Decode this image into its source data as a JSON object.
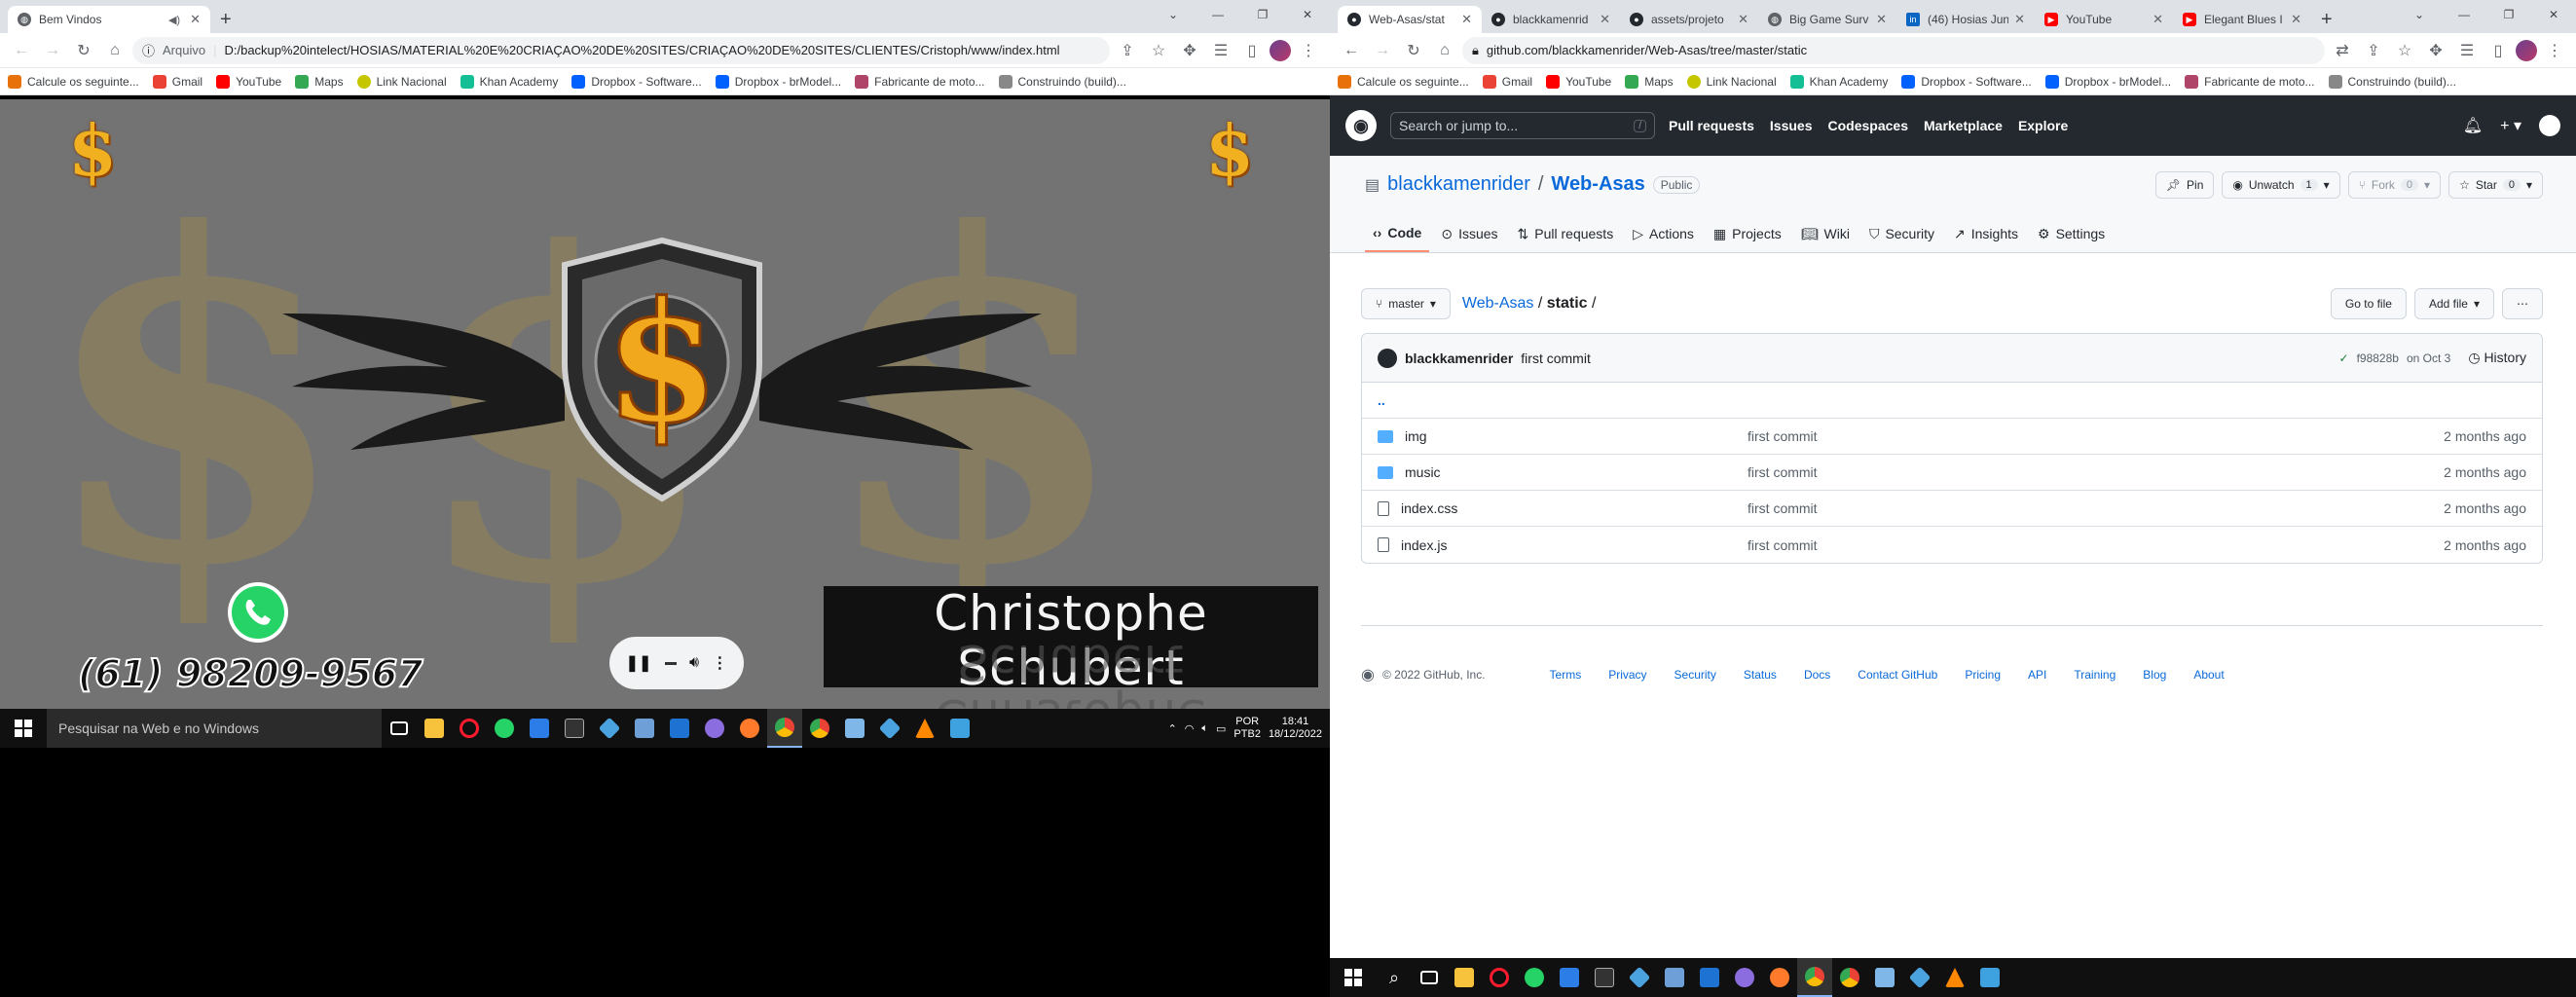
{
  "left": {
    "tabs": [
      {
        "title": "Bem Vindos"
      }
    ],
    "address_prefix": "Arquivo",
    "address": "D:/backup%20intelect/HOSIAS/MATERIAL%20E%20CRIA%C3%87%C3%83O%20DE%20SITES/CRIA%C3%87%C3%83O%20DE%20SITES/CLIENTES/Cristoph/www/index.html",
    "address_display": "D:/backup%20intelect/HOSIAS/MATERIAL%20E%20CRIAÇAO%20DE%20SITES/CRIAÇAO%20DE%20SITES/CLIENTES/Cristoph/www/index.html",
    "bookmarks": [
      "Calcule os seguinte...",
      "Gmail",
      "YouTube",
      "Maps",
      "Link Nacional",
      "Khan Academy",
      "Dropbox - Software...",
      "Dropbox - brModel...",
      "Fabricante de moto...",
      "Construindo (build)..."
    ],
    "site": {
      "name": "Christophe Schubert",
      "phone": "(61) 98209-9567"
    },
    "taskbar": {
      "search_placeholder": "Pesquisar na Web e no Windows",
      "lang1": "POR",
      "lang2": "PTB2",
      "time": "18:41",
      "date": "18/12/2022"
    }
  },
  "right": {
    "tabs": [
      {
        "title": "Web-Asas/stat"
      },
      {
        "title": "blackkamenrid"
      },
      {
        "title": "assets/projeto"
      },
      {
        "title": "Big Game Surv"
      },
      {
        "title": "(46) Hosias Jun"
      },
      {
        "title": "YouTube"
      },
      {
        "title": "Elegant Blues I"
      }
    ],
    "address": "github.com/blackkamenrider/Web-Asas/tree/master/static",
    "bookmarks": [
      "Calcule os seguinte...",
      "Gmail",
      "YouTube",
      "Maps",
      "Link Nacional",
      "Khan Academy",
      "Dropbox - Software...",
      "Dropbox - brModel...",
      "Fabricante de moto...",
      "Construindo (build)..."
    ],
    "github": {
      "search_placeholder": "Search or jump to...",
      "search_key": "/",
      "nav": [
        "Pull requests",
        "Issues",
        "Codespaces",
        "Marketplace",
        "Explore"
      ],
      "owner": "blackkamenrider",
      "repo": "Web-Asas",
      "visibility": "Public",
      "pin": "Pin",
      "unwatch": "Unwatch",
      "unwatch_count": "1",
      "fork": "Fork",
      "fork_count": "0",
      "star": "Star",
      "star_count": "0",
      "repo_tabs": [
        "Code",
        "Issues",
        "Pull requests",
        "Actions",
        "Projects",
        "Wiki",
        "Security",
        "Insights",
        "Settings"
      ],
      "branch": "master",
      "path_repo": "Web-Asas",
      "path_dir": "static",
      "go_to_file": "Go to file",
      "add_file": "Add file",
      "commit_author": "blackkamenrider",
      "commit_msg": "first commit",
      "commit_hash": "f98828b",
      "commit_date": "on Oct 3",
      "history": "History",
      "parent": "..",
      "files": [
        {
          "name": "img",
          "type": "dir",
          "msg": "first commit",
          "age": "2 months ago"
        },
        {
          "name": "music",
          "type": "dir",
          "msg": "first commit",
          "age": "2 months ago"
        },
        {
          "name": "index.css",
          "type": "file",
          "msg": "first commit",
          "age": "2 months ago"
        },
        {
          "name": "index.js",
          "type": "file",
          "msg": "first commit",
          "age": "2 months ago"
        }
      ],
      "copyright": "© 2022 GitHub, Inc.",
      "footer_links": [
        "Terms",
        "Privacy",
        "Security",
        "Status",
        "Docs",
        "Contact GitHub",
        "Pricing",
        "API",
        "Training",
        "Blog",
        "About"
      ]
    }
  },
  "colors": {
    "github_header": "#24292f",
    "link": "#0969da",
    "taskbar": "#101010"
  }
}
